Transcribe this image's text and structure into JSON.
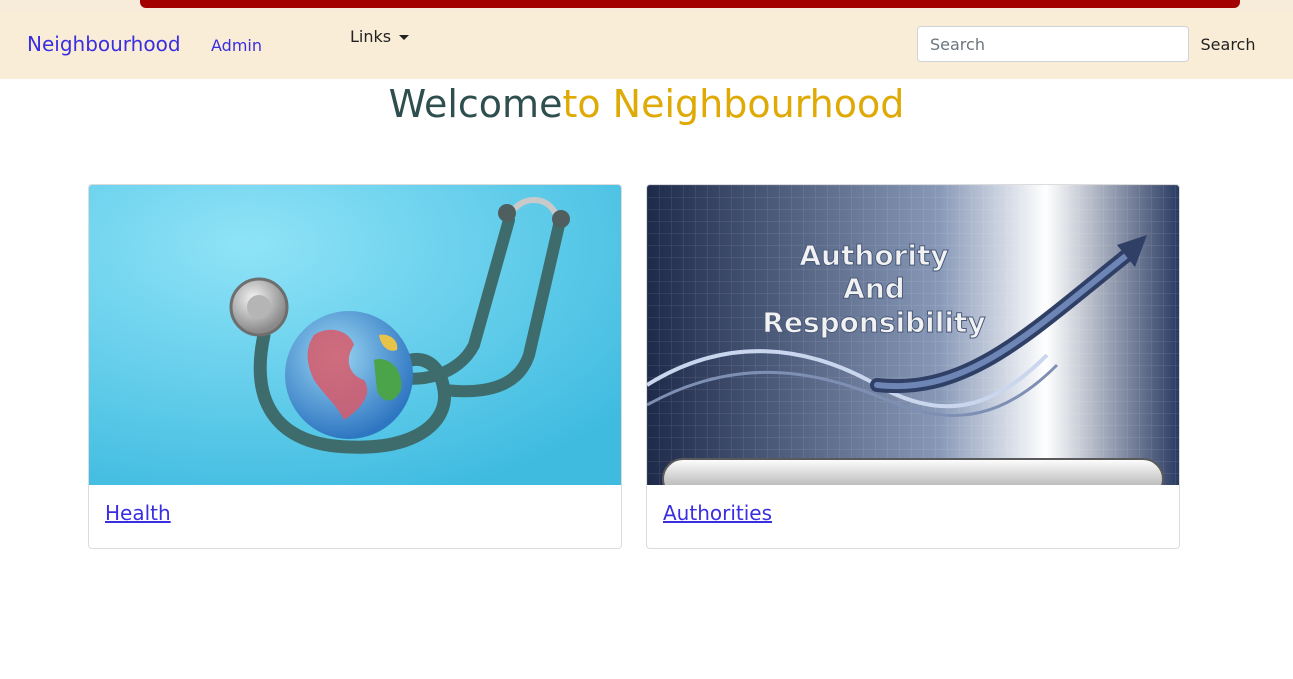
{
  "navbar": {
    "brand": "Neighbourhood",
    "admin_label": "Admin",
    "links_label": "Links",
    "search": {
      "placeholder": "Search",
      "value": ""
    },
    "search_button": "Search"
  },
  "headline": {
    "part1": "Welcome",
    "part2": "to Neighbourhood"
  },
  "cards": [
    {
      "title": "Health",
      "image": "stethoscope-globe"
    },
    {
      "title": "Authorities",
      "image": "authority-and-responsibility-graphic",
      "image_text": [
        "Authority",
        "And",
        "Responsibility"
      ]
    }
  ],
  "colors": {
    "brand_link": "#3a2fe0",
    "navbar_bg": "#f9edd7",
    "headline_dark": "#2f4f4f",
    "headline_gold": "#dfaa06"
  }
}
